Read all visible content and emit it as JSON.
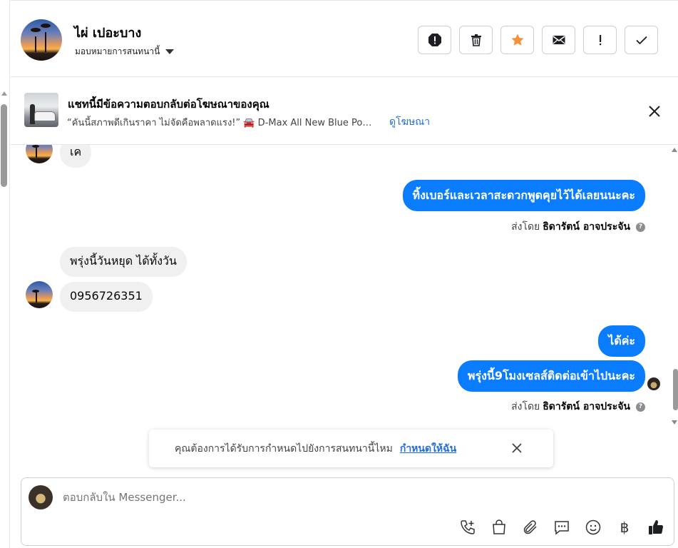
{
  "header": {
    "contact_name": "ไผ่ เปอะบาง",
    "assign_label": "มอบหมายการสนทนานี้",
    "actions": [
      "spam-icon",
      "trash-icon",
      "star-icon",
      "mail-icon",
      "important-icon",
      "check-icon"
    ],
    "colors": {
      "star": "#f7923a"
    }
  },
  "ad": {
    "title": "แชทนี้มีข้อความตอบกลับต่อโฆษณาของคุณ",
    "quote": "“คันนี้สภาพดีเกินราคา ไม่จัดคือพลาดแรง!” 🚘 D-Max All New Blue Power",
    "link": "ดูโฆษณา"
  },
  "messages": {
    "in_1": "เค",
    "out_1": "ทิ้งเบอร์และเวลาสะดวกพูดคุยไว้ได้เลยนนะคะ",
    "sent_by_prefix": "ส่งโดย",
    "sent_by_name": "ธิดารัตน์ อาจประจัน",
    "in_2": "พรุ่งนี้วันหยุด ได้ทั้งวัน",
    "in_3": "0956726351",
    "out_2": "ได้ค่ะ",
    "out_3": "พรุ่งนี้9โมงเซลส์ติดต่อเข้าไปนะคะ",
    "colors": {
      "outgoing": "#0a7cff",
      "incoming": "#f0f0f0"
    }
  },
  "toast": {
    "text": "คุณต้องการได้รับการกำหนดไปยังการสนทนานี้ไหม",
    "link": "กำหนดให้ฉัน"
  },
  "composer": {
    "placeholder": "ตอบกลับใน Messenger...",
    "tools": [
      "call-add-icon",
      "shopping-bag-icon",
      "attachment-icon",
      "saved-reply-icon",
      "emoji-icon",
      "payment-icon",
      "like-icon"
    ],
    "baht_symbol": "฿"
  }
}
